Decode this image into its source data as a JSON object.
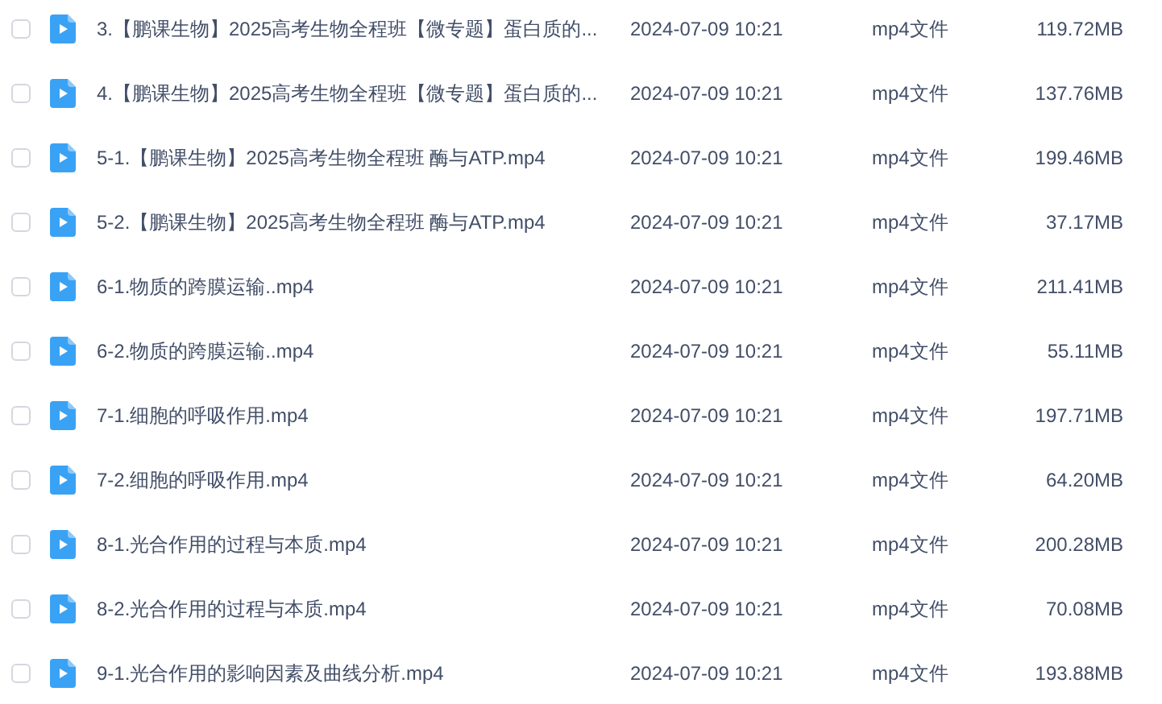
{
  "files": [
    {
      "name": "3.【鹏课生物】2025高考生物全程班【微专题】蛋白质的...",
      "date": "2024-07-09 10:21",
      "type": "mp4文件",
      "size": "119.72MB",
      "checked": false
    },
    {
      "name": "4.【鹏课生物】2025高考生物全程班【微专题】蛋白质的...",
      "date": "2024-07-09 10:21",
      "type": "mp4文件",
      "size": "137.76MB",
      "checked": false
    },
    {
      "name": "5-1.【鹏课生物】2025高考生物全程班 酶与ATP.mp4",
      "date": "2024-07-09 10:21",
      "type": "mp4文件",
      "size": "199.46MB",
      "checked": false
    },
    {
      "name": "5-2.【鹏课生物】2025高考生物全程班 酶与ATP.mp4",
      "date": "2024-07-09 10:21",
      "type": "mp4文件",
      "size": "37.17MB",
      "checked": false
    },
    {
      "name": "6-1.物质的跨膜运输..mp4",
      "date": "2024-07-09 10:21",
      "type": "mp4文件",
      "size": "211.41MB",
      "checked": false
    },
    {
      "name": "6-2.物质的跨膜运输..mp4",
      "date": "2024-07-09 10:21",
      "type": "mp4文件",
      "size": "55.11MB",
      "checked": false
    },
    {
      "name": "7-1.细胞的呼吸作用.mp4",
      "date": "2024-07-09 10:21",
      "type": "mp4文件",
      "size": "197.71MB",
      "checked": false
    },
    {
      "name": "7-2.细胞的呼吸作用.mp4",
      "date": "2024-07-09 10:21",
      "type": "mp4文件",
      "size": "64.20MB",
      "checked": false
    },
    {
      "name": "8-1.光合作用的过程与本质.mp4",
      "date": "2024-07-09 10:21",
      "type": "mp4文件",
      "size": "200.28MB",
      "checked": false
    },
    {
      "name": "8-2.光合作用的过程与本质.mp4",
      "date": "2024-07-09 10:21",
      "type": "mp4文件",
      "size": "70.08MB",
      "checked": false
    },
    {
      "name": "9-1.光合作用的影响因素及曲线分析.mp4",
      "date": "2024-07-09 10:21",
      "type": "mp4文件",
      "size": "193.88MB",
      "checked": false
    }
  ]
}
